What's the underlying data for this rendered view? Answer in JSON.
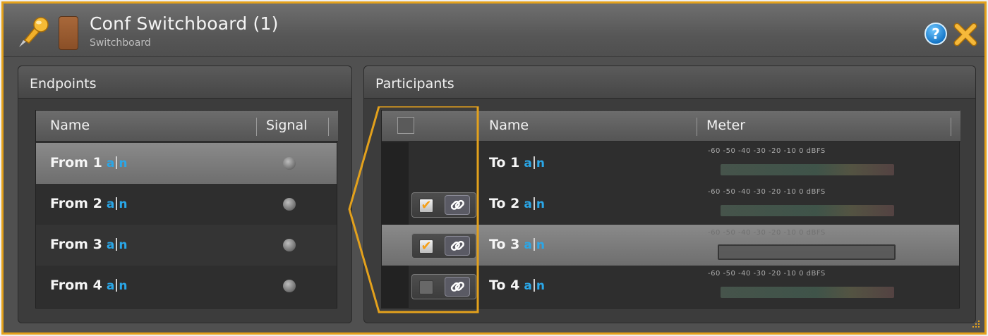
{
  "window": {
    "title": "Conf Switchboard (1)",
    "subtitle": "Switchboard",
    "accent_color": "#e3a11c",
    "swatch_color": "#9a5a2e",
    "icons": [
      "pin-icon",
      "help-icon",
      "close-icon",
      "resize-grip-icon"
    ]
  },
  "endpoints": {
    "title": "Endpoints",
    "columns": [
      "Name",
      "Signal"
    ],
    "rows": [
      {
        "name": "From 1",
        "selected": true
      },
      {
        "name": "From 2",
        "selected": false
      },
      {
        "name": "From 3",
        "selected": false
      },
      {
        "name": "From 4",
        "selected": false
      }
    ],
    "name_badge": {
      "a": "a",
      "n": "n"
    }
  },
  "participants": {
    "title": "Participants",
    "columns": [
      "Name",
      "Meter"
    ],
    "meter_scale": "-60  -50  -40  -30  -20  -10   0  dBFS",
    "rows": [
      {
        "name": "To 1",
        "checked": null,
        "selected": false
      },
      {
        "name": "To 2",
        "checked": true,
        "selected": false
      },
      {
        "name": "To 3",
        "checked": true,
        "selected": true
      },
      {
        "name": "To 4",
        "checked": false,
        "selected": false
      }
    ],
    "help_glyph": "?",
    "check_glyph": "✔"
  }
}
